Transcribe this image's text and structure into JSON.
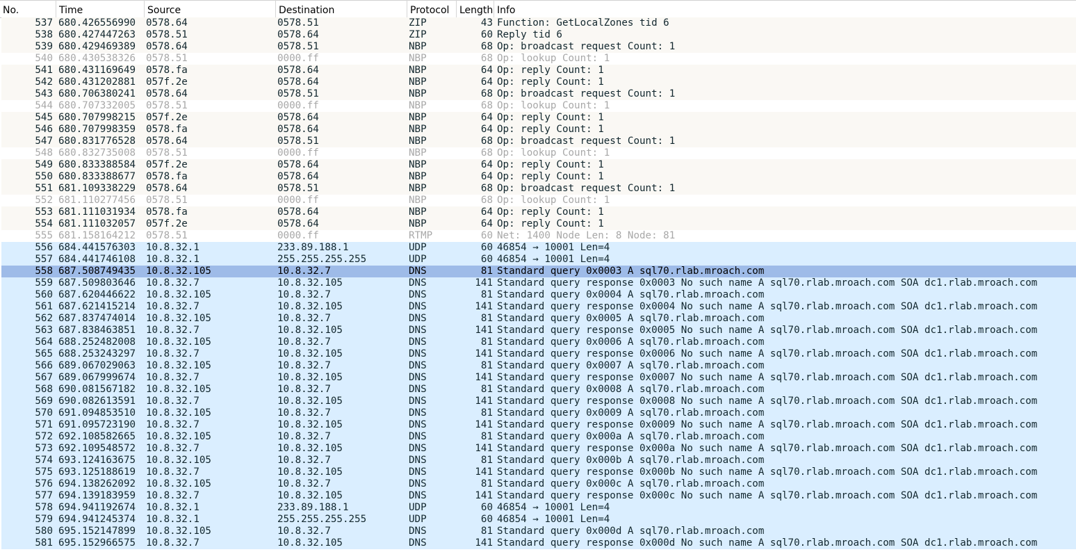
{
  "columns": {
    "no": "No.",
    "time": "Time",
    "source": "Source",
    "destination": "Destination",
    "protocol": "Protocol",
    "length": "Length",
    "info": "Info"
  },
  "colors": {
    "appletalk_row": "#faf8f4",
    "disabled_row": "#ffffff",
    "udp_row": "#daeeff",
    "selected_row": "#9ebbe8",
    "disabled_text": "#a8a8a8",
    "normal_text": "#12272e"
  },
  "packets": [
    {
      "no": "537",
      "time": "680.426556990",
      "src": "0578.64",
      "dst": "0578.51",
      "proto": "ZIP",
      "len": "43",
      "info": "Function: GetLocalZones  tid 6",
      "style": "appletalk"
    },
    {
      "no": "538",
      "time": "680.427447263",
      "src": "0578.51",
      "dst": "0578.64",
      "proto": "ZIP",
      "len": "60",
      "info": "Reply tid 6",
      "style": "appletalk"
    },
    {
      "no": "539",
      "time": "680.429469389",
      "src": "0578.64",
      "dst": "0578.51",
      "proto": "NBP",
      "len": "68",
      "info": "Op: broadcast request  Count: 1",
      "style": "appletalk"
    },
    {
      "no": "540",
      "time": "680.430538326",
      "src": "0578.51",
      "dst": "0000.ff",
      "proto": "NBP",
      "len": "68",
      "info": "Op: lookup  Count: 1",
      "style": "disabled"
    },
    {
      "no": "541",
      "time": "680.431169649",
      "src": "0578.fa",
      "dst": "0578.64",
      "proto": "NBP",
      "len": "64",
      "info": "Op: reply  Count: 1",
      "style": "appletalk"
    },
    {
      "no": "542",
      "time": "680.431202881",
      "src": "057f.2e",
      "dst": "0578.64",
      "proto": "NBP",
      "len": "64",
      "info": "Op: reply  Count: 1",
      "style": "appletalk"
    },
    {
      "no": "543",
      "time": "680.706380241",
      "src": "0578.64",
      "dst": "0578.51",
      "proto": "NBP",
      "len": "68",
      "info": "Op: broadcast request  Count: 1",
      "style": "appletalk"
    },
    {
      "no": "544",
      "time": "680.707332005",
      "src": "0578.51",
      "dst": "0000.ff",
      "proto": "NBP",
      "len": "68",
      "info": "Op: lookup  Count: 1",
      "style": "disabled"
    },
    {
      "no": "545",
      "time": "680.707998215",
      "src": "057f.2e",
      "dst": "0578.64",
      "proto": "NBP",
      "len": "64",
      "info": "Op: reply  Count: 1",
      "style": "appletalk"
    },
    {
      "no": "546",
      "time": "680.707998359",
      "src": "0578.fa",
      "dst": "0578.64",
      "proto": "NBP",
      "len": "64",
      "info": "Op: reply  Count: 1",
      "style": "appletalk"
    },
    {
      "no": "547",
      "time": "680.831776528",
      "src": "0578.64",
      "dst": "0578.51",
      "proto": "NBP",
      "len": "68",
      "info": "Op: broadcast request  Count: 1",
      "style": "appletalk"
    },
    {
      "no": "548",
      "time": "680.832735008",
      "src": "0578.51",
      "dst": "0000.ff",
      "proto": "NBP",
      "len": "68",
      "info": "Op: lookup  Count: 1",
      "style": "disabled"
    },
    {
      "no": "549",
      "time": "680.833388584",
      "src": "057f.2e",
      "dst": "0578.64",
      "proto": "NBP",
      "len": "64",
      "info": "Op: reply  Count: 1",
      "style": "appletalk"
    },
    {
      "no": "550",
      "time": "680.833388677",
      "src": "0578.fa",
      "dst": "0578.64",
      "proto": "NBP",
      "len": "64",
      "info": "Op: reply  Count: 1",
      "style": "appletalk"
    },
    {
      "no": "551",
      "time": "681.109338229",
      "src": "0578.64",
      "dst": "0578.51",
      "proto": "NBP",
      "len": "68",
      "info": "Op: broadcast request  Count: 1",
      "style": "appletalk"
    },
    {
      "no": "552",
      "time": "681.110277456",
      "src": "0578.51",
      "dst": "0000.ff",
      "proto": "NBP",
      "len": "68",
      "info": "Op: lookup  Count: 1",
      "style": "disabled"
    },
    {
      "no": "553",
      "time": "681.111031934",
      "src": "0578.fa",
      "dst": "0578.64",
      "proto": "NBP",
      "len": "64",
      "info": "Op: reply  Count: 1",
      "style": "appletalk"
    },
    {
      "no": "554",
      "time": "681.111032057",
      "src": "057f.2e",
      "dst": "0578.64",
      "proto": "NBP",
      "len": "64",
      "info": "Op: reply  Count: 1",
      "style": "appletalk"
    },
    {
      "no": "555",
      "time": "681.158164212",
      "src": "0578.51",
      "dst": "0000.ff",
      "proto": "RTMP",
      "len": "60",
      "info": "Net: 1400  Node Len: 8  Node: 81",
      "style": "disabled"
    },
    {
      "no": "556",
      "time": "684.441576303",
      "src": "10.8.32.1",
      "dst": "233.89.188.1",
      "proto": "UDP",
      "len": "60",
      "info": "46854 → 10001 Len=4",
      "style": "udp"
    },
    {
      "no": "557",
      "time": "684.441746108",
      "src": "10.8.32.1",
      "dst": "255.255.255.255",
      "proto": "UDP",
      "len": "60",
      "info": "46854 → 10001 Len=4",
      "style": "udp"
    },
    {
      "no": "558",
      "time": "687.508749435",
      "src": "10.8.32.105",
      "dst": "10.8.32.7",
      "proto": "DNS",
      "len": "81",
      "info": "Standard query 0x0003 A sql70.rlab.mroach.com",
      "style": "selected"
    },
    {
      "no": "559",
      "time": "687.509803646",
      "src": "10.8.32.7",
      "dst": "10.8.32.105",
      "proto": "DNS",
      "len": "141",
      "info": "Standard query response 0x0003 No such name A sql70.rlab.mroach.com SOA dc1.rlab.mroach.com",
      "style": "udp"
    },
    {
      "no": "560",
      "time": "687.620446622",
      "src": "10.8.32.105",
      "dst": "10.8.32.7",
      "proto": "DNS",
      "len": "81",
      "info": "Standard query 0x0004 A sql70.rlab.mroach.com",
      "style": "udp"
    },
    {
      "no": "561",
      "time": "687.621415214",
      "src": "10.8.32.7",
      "dst": "10.8.32.105",
      "proto": "DNS",
      "len": "141",
      "info": "Standard query response 0x0004 No such name A sql70.rlab.mroach.com SOA dc1.rlab.mroach.com",
      "style": "udp"
    },
    {
      "no": "562",
      "time": "687.837474014",
      "src": "10.8.32.105",
      "dst": "10.8.32.7",
      "proto": "DNS",
      "len": "81",
      "info": "Standard query 0x0005 A sql70.rlab.mroach.com",
      "style": "udp"
    },
    {
      "no": "563",
      "time": "687.838463851",
      "src": "10.8.32.7",
      "dst": "10.8.32.105",
      "proto": "DNS",
      "len": "141",
      "info": "Standard query response 0x0005 No such name A sql70.rlab.mroach.com SOA dc1.rlab.mroach.com",
      "style": "udp"
    },
    {
      "no": "564",
      "time": "688.252482008",
      "src": "10.8.32.105",
      "dst": "10.8.32.7",
      "proto": "DNS",
      "len": "81",
      "info": "Standard query 0x0006 A sql70.rlab.mroach.com",
      "style": "udp"
    },
    {
      "no": "565",
      "time": "688.253243297",
      "src": "10.8.32.7",
      "dst": "10.8.32.105",
      "proto": "DNS",
      "len": "141",
      "info": "Standard query response 0x0006 No such name A sql70.rlab.mroach.com SOA dc1.rlab.mroach.com",
      "style": "udp"
    },
    {
      "no": "566",
      "time": "689.067029063",
      "src": "10.8.32.105",
      "dst": "10.8.32.7",
      "proto": "DNS",
      "len": "81",
      "info": "Standard query 0x0007 A sql70.rlab.mroach.com",
      "style": "udp"
    },
    {
      "no": "567",
      "time": "689.067999674",
      "src": "10.8.32.7",
      "dst": "10.8.32.105",
      "proto": "DNS",
      "len": "141",
      "info": "Standard query response 0x0007 No such name A sql70.rlab.mroach.com SOA dc1.rlab.mroach.com",
      "style": "udp"
    },
    {
      "no": "568",
      "time": "690.081567182",
      "src": "10.8.32.105",
      "dst": "10.8.32.7",
      "proto": "DNS",
      "len": "81",
      "info": "Standard query 0x0008 A sql70.rlab.mroach.com",
      "style": "udp"
    },
    {
      "no": "569",
      "time": "690.082613591",
      "src": "10.8.32.7",
      "dst": "10.8.32.105",
      "proto": "DNS",
      "len": "141",
      "info": "Standard query response 0x0008 No such name A sql70.rlab.mroach.com SOA dc1.rlab.mroach.com",
      "style": "udp"
    },
    {
      "no": "570",
      "time": "691.094853510",
      "src": "10.8.32.105",
      "dst": "10.8.32.7",
      "proto": "DNS",
      "len": "81",
      "info": "Standard query 0x0009 A sql70.rlab.mroach.com",
      "style": "udp"
    },
    {
      "no": "571",
      "time": "691.095723190",
      "src": "10.8.32.7",
      "dst": "10.8.32.105",
      "proto": "DNS",
      "len": "141",
      "info": "Standard query response 0x0009 No such name A sql70.rlab.mroach.com SOA dc1.rlab.mroach.com",
      "style": "udp"
    },
    {
      "no": "572",
      "time": "692.108582665",
      "src": "10.8.32.105",
      "dst": "10.8.32.7",
      "proto": "DNS",
      "len": "81",
      "info": "Standard query 0x000a A sql70.rlab.mroach.com",
      "style": "udp"
    },
    {
      "no": "573",
      "time": "692.109548572",
      "src": "10.8.32.7",
      "dst": "10.8.32.105",
      "proto": "DNS",
      "len": "141",
      "info": "Standard query response 0x000a No such name A sql70.rlab.mroach.com SOA dc1.rlab.mroach.com",
      "style": "udp"
    },
    {
      "no": "574",
      "time": "693.124163675",
      "src": "10.8.32.105",
      "dst": "10.8.32.7",
      "proto": "DNS",
      "len": "81",
      "info": "Standard query 0x000b A sql70.rlab.mroach.com",
      "style": "udp"
    },
    {
      "no": "575",
      "time": "693.125188619",
      "src": "10.8.32.7",
      "dst": "10.8.32.105",
      "proto": "DNS",
      "len": "141",
      "info": "Standard query response 0x000b No such name A sql70.rlab.mroach.com SOA dc1.rlab.mroach.com",
      "style": "udp"
    },
    {
      "no": "576",
      "time": "694.138262092",
      "src": "10.8.32.105",
      "dst": "10.8.32.7",
      "proto": "DNS",
      "len": "81",
      "info": "Standard query 0x000c A sql70.rlab.mroach.com",
      "style": "udp"
    },
    {
      "no": "577",
      "time": "694.139183959",
      "src": "10.8.32.7",
      "dst": "10.8.32.105",
      "proto": "DNS",
      "len": "141",
      "info": "Standard query response 0x000c No such name A sql70.rlab.mroach.com SOA dc1.rlab.mroach.com",
      "style": "udp"
    },
    {
      "no": "578",
      "time": "694.941192674",
      "src": "10.8.32.1",
      "dst": "233.89.188.1",
      "proto": "UDP",
      "len": "60",
      "info": "46854 → 10001 Len=4",
      "style": "udp"
    },
    {
      "no": "579",
      "time": "694.941245374",
      "src": "10.8.32.1",
      "dst": "255.255.255.255",
      "proto": "UDP",
      "len": "60",
      "info": "46854 → 10001 Len=4",
      "style": "udp"
    },
    {
      "no": "580",
      "time": "695.152147899",
      "src": "10.8.32.105",
      "dst": "10.8.32.7",
      "proto": "DNS",
      "len": "81",
      "info": "Standard query 0x000d A sql70.rlab.mroach.com",
      "style": "udp"
    },
    {
      "no": "581",
      "time": "695.152966575",
      "src": "10.8.32.7",
      "dst": "10.8.32.105",
      "proto": "DNS",
      "len": "141",
      "info": "Standard query response 0x000d No such name A sql70.rlab.mroach.com SOA dc1.rlab.mroach.com",
      "style": "udp"
    }
  ]
}
